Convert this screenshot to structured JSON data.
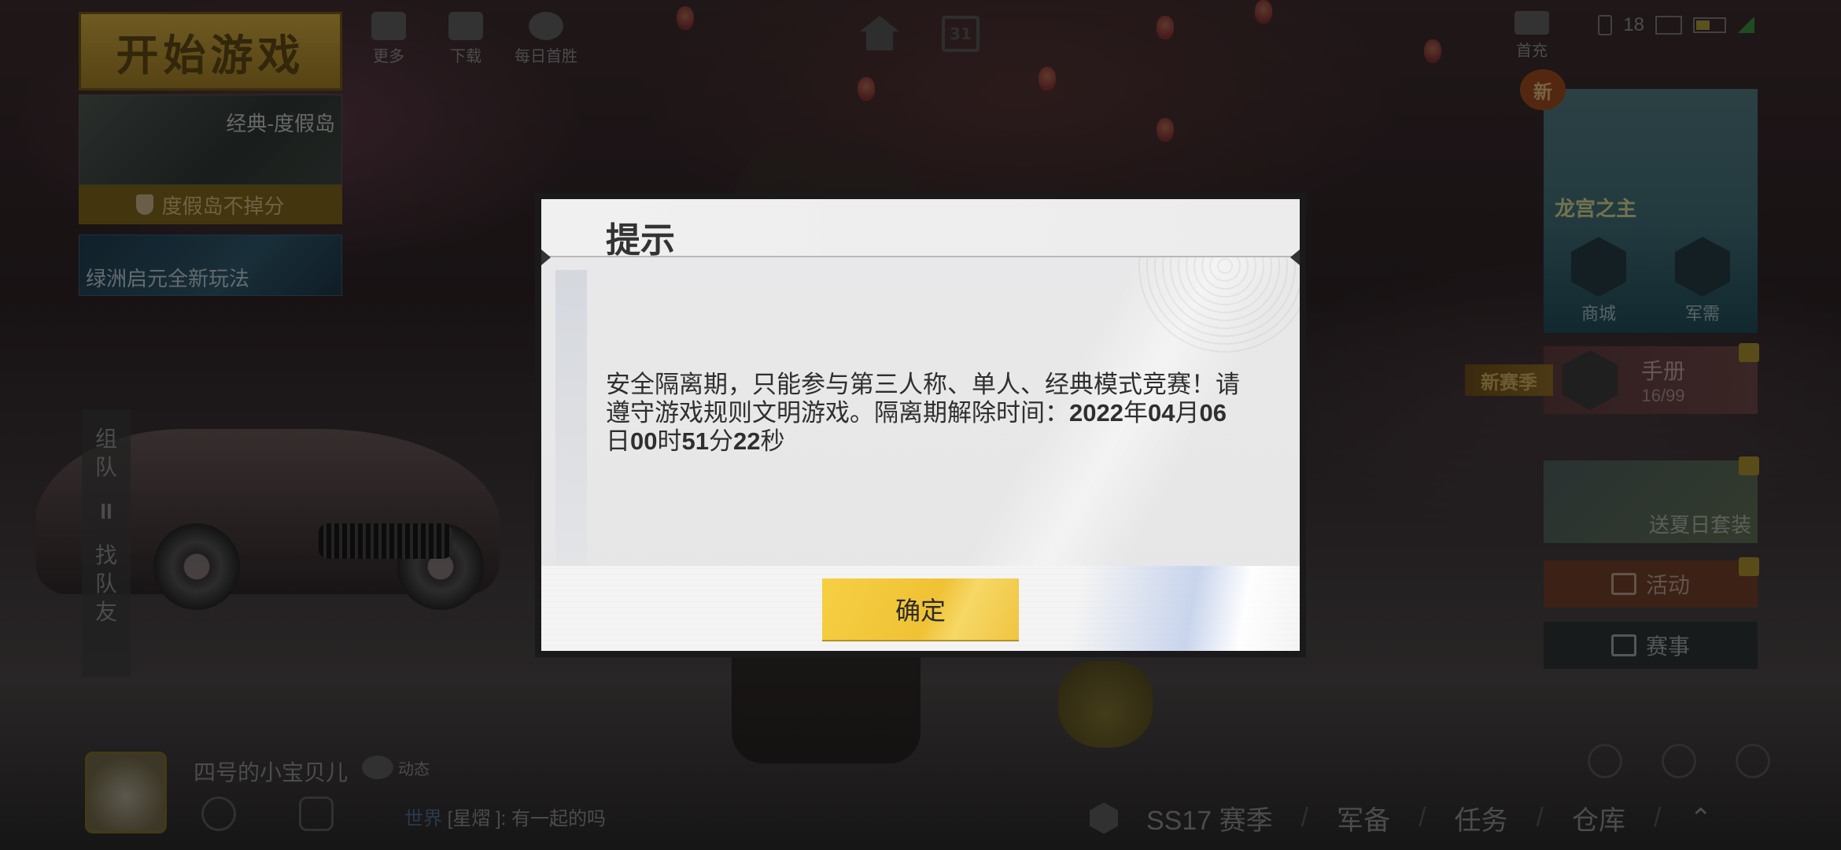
{
  "top_left": {
    "start_game": "开始游戏",
    "mode_name": "经典-度假岛",
    "mode_tag": "度假岛不掉分",
    "oasis_label": "绿洲启元全新玩法"
  },
  "top_bar": {
    "more": "更多",
    "download": "下载",
    "daily_win": "每日首胜",
    "calendar_day": "31",
    "first_charge": "首充"
  },
  "status": {
    "time": "18"
  },
  "right_column": {
    "new_badge": "新",
    "event_title": "龙宫之主",
    "shop": "商城",
    "armory": "军需",
    "new_season": "新赛季",
    "handbook_title": "手册",
    "handbook_progress": "16/99",
    "summer_outfit": "送夏日套装",
    "activity": "活动",
    "events": "赛事"
  },
  "team_panel": {
    "team_top": "组",
    "team_bottom": "队",
    "pause": "II",
    "find_1": "找",
    "find_2": "队",
    "find_3": "友"
  },
  "player": {
    "name": "四号的小宝贝儿",
    "dynamic": "动态"
  },
  "chat": {
    "channel": "世界",
    "message": " [星熠 ]: 有一起的吗"
  },
  "bottom_nav": {
    "season": "SS17 赛季",
    "gear": "军备",
    "tasks": "任务",
    "warehouse": "仓库"
  },
  "dialog": {
    "title": "提示",
    "message_part1": "安全隔离期，只能参与第三人称、单人、经典模式竞赛！请遵守游戏规则文明游戏。隔离期解除时间：",
    "release_year": "2022",
    "year_unit": "年",
    "release_month": "04",
    "month_unit": "月",
    "release_day": "06",
    "day_unit": "日",
    "release_hour": "00",
    "hour_unit": "时",
    "release_minute": "51",
    "minute_unit": "分",
    "release_second": "22",
    "second_unit": "秒",
    "confirm": "确定"
  },
  "colors": {
    "confirm_button": "#f2c73a",
    "dialog_bg": "#e7e7e8",
    "overlay": "rgba(0,0,0,0.45)"
  }
}
